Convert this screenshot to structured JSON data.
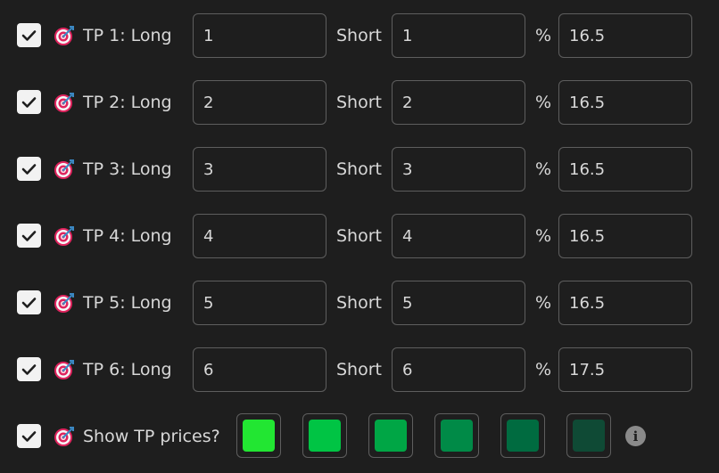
{
  "tp_rows": [
    {
      "label": "TP 1: Long",
      "long_value": "1",
      "short_label": "Short",
      "short_value": "1",
      "percent_label": "%",
      "percent_value": "16.5",
      "checked": true
    },
    {
      "label": "TP 2: Long",
      "long_value": "2",
      "short_label": "Short",
      "short_value": "2",
      "percent_label": "%",
      "percent_value": "16.5",
      "checked": true
    },
    {
      "label": "TP 3: Long",
      "long_value": "3",
      "short_label": "Short",
      "short_value": "3",
      "percent_label": "%",
      "percent_value": "16.5",
      "checked": true
    },
    {
      "label": "TP 4: Long",
      "long_value": "4",
      "short_label": "Short",
      "short_value": "4",
      "percent_label": "%",
      "percent_value": "16.5",
      "checked": true
    },
    {
      "label": "TP 5: Long",
      "long_value": "5",
      "short_label": "Short",
      "short_value": "5",
      "percent_label": "%",
      "percent_value": "16.5",
      "checked": true
    },
    {
      "label": "TP 6: Long",
      "long_value": "6",
      "short_label": "Short",
      "short_value": "6",
      "percent_label": "%",
      "percent_value": "17.5",
      "checked": true
    }
  ],
  "show_prices": {
    "label": "Show TP prices?",
    "checked": true,
    "swatch_colors": [
      "#22e632",
      "#00c444",
      "#00a645",
      "#008a47",
      "#006b40",
      "#0f4a35"
    ]
  },
  "icons": {
    "checkbox": "checkmark-icon",
    "row_icon": "target-dart-icon",
    "info": "info-icon"
  },
  "colors": {
    "background": "#1e1e1e",
    "field_border": "#5e5e5e",
    "text": "#d8d8d8",
    "checkbox_fill": "#f2f2f2"
  }
}
